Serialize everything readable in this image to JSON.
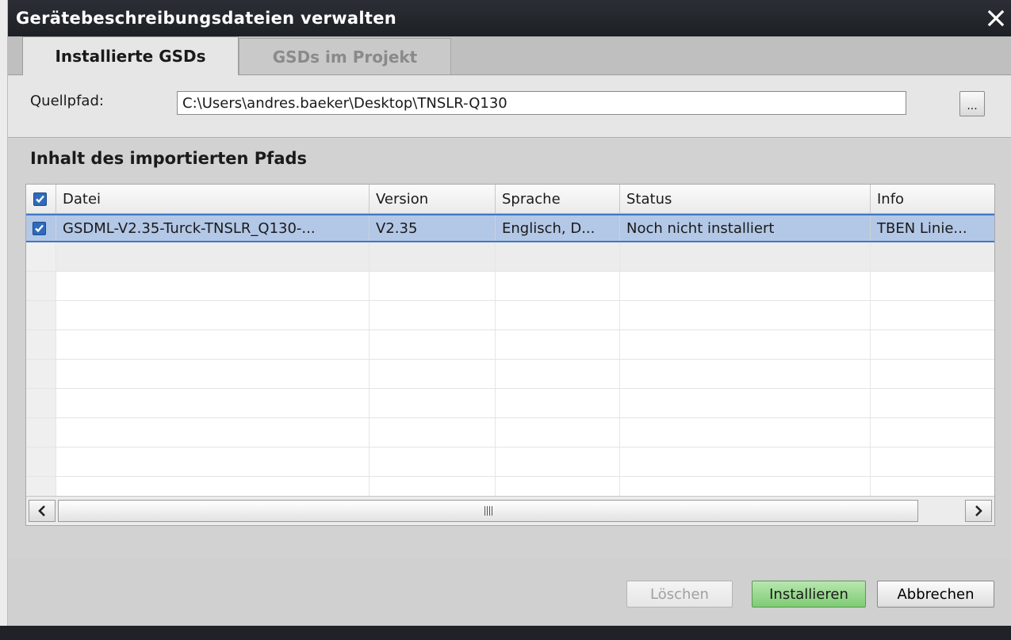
{
  "window": {
    "title": "Gerätebeschreibungsdateien verwalten",
    "close_icon": "close-icon"
  },
  "tabs": [
    {
      "label": "Installierte GSDs",
      "active": true
    },
    {
      "label": "GSDs im Projekt",
      "active": false
    }
  ],
  "source": {
    "label": "Quellpfad:",
    "path": "C:\\Users\\andres.baeker\\Desktop\\TNSLR-Q130",
    "browse_label": "..."
  },
  "content": {
    "heading": "Inhalt des importierten Pfads",
    "header_checkbox_checked": true,
    "columns": [
      "Datei",
      "Version",
      "Sprache",
      "Status",
      "Info"
    ],
    "rows": [
      {
        "checked": true,
        "selected": true,
        "datei": "GSDML-V2.35-Turck-TNSLR_Q130-...",
        "version": "V2.35",
        "sprache": "Englisch, D...",
        "status": "Noch nicht installiert",
        "info": "TBEN Linie..."
      }
    ]
  },
  "scrollbar": {
    "left_icon": "chevron-left-icon",
    "right_icon": "chevron-right-icon"
  },
  "buttons": {
    "delete": "Löschen",
    "install": "Installieren",
    "cancel": "Abbrechen"
  },
  "colors": {
    "title_bar": "#1d2126",
    "selection": "#b3c7e6",
    "checkbox": "#2e6bbd",
    "install_button": "#7fcc74"
  }
}
